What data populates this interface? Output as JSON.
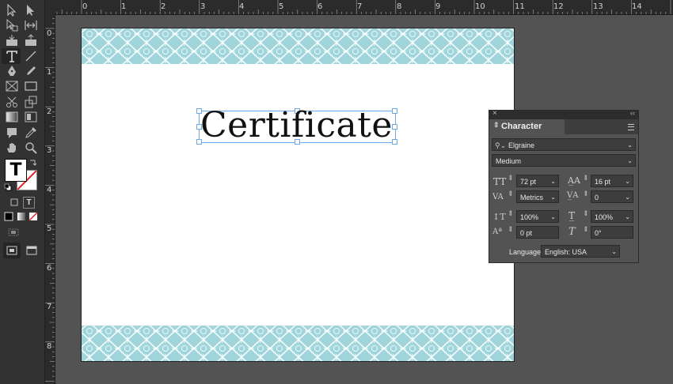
{
  "ruler": {
    "top": [
      "0",
      "1",
      "2",
      "3",
      "4",
      "5",
      "6",
      "7",
      "8",
      "9",
      "10",
      "11",
      "12",
      "13",
      "14"
    ],
    "left": [
      "0",
      "1",
      "2",
      "3",
      "4",
      "5",
      "6",
      "7",
      "8"
    ]
  },
  "document": {
    "title_text": "Certificate",
    "band_color": "#9fd5db"
  },
  "character_panel": {
    "tab_label": "Character",
    "font_family": "Elgraine",
    "font_style": "Medium",
    "font_size": "72 pt",
    "leading": "16 pt",
    "kerning": "Metrics",
    "tracking": "0",
    "vertical_scale": "100%",
    "horizontal_scale": "100%",
    "baseline_shift": "0 pt",
    "skew": "0°",
    "language_label": "Language:",
    "language_value": "English: USA"
  },
  "tools": [
    "selection-tool",
    "direct-selection-tool",
    "page-tool",
    "gap-tool",
    "content-collector-tool",
    "content-placer-tool",
    "type-tool",
    "line-tool",
    "pen-tool",
    "pencil-tool",
    "rectangle-frame-tool",
    "rectangle-tool",
    "scissors-tool",
    "free-transform-tool",
    "gradient-swatch-tool",
    "gradient-feather-tool",
    "note-tool",
    "eyedropper-tool",
    "hand-tool",
    "zoom-tool"
  ]
}
